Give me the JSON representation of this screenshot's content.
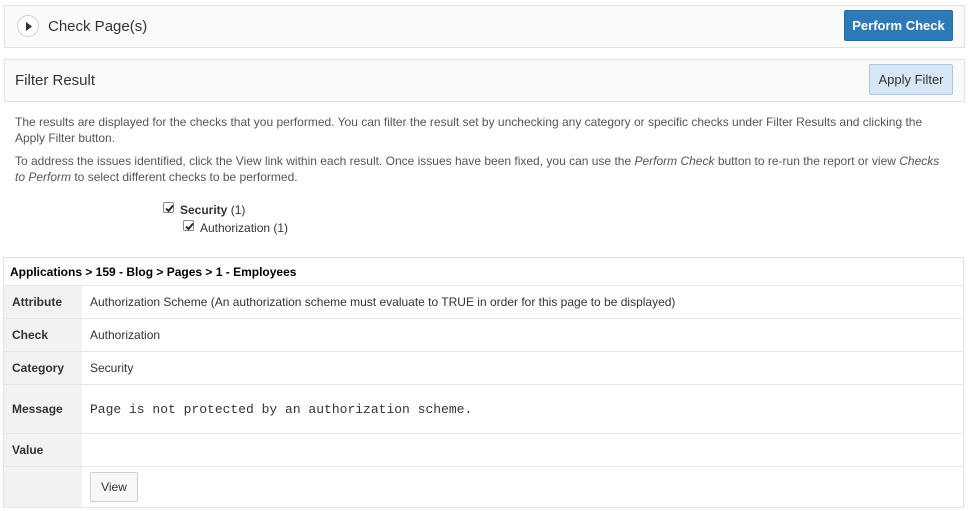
{
  "check_region": {
    "title": "Check Page(s)",
    "perform_button": "Perform Check"
  },
  "filter_region": {
    "title": "Filter Result",
    "apply_button": "Apply Filter"
  },
  "description": {
    "p1": "The results are displayed for the checks that you performed. You can filter the result set by unchecking any category or specific checks under Filter Results and clicking the Apply Filter button.",
    "p2_a": "To address the issues identified, click the View link within each result. Once issues have been fixed, you can use the ",
    "p2_em1": "Perform Check",
    "p2_b": " button to re-run the report or view ",
    "p2_em2": "Checks to Perform",
    "p2_c": " to select different checks to be performed."
  },
  "filters": {
    "category_label": "Security",
    "category_count": "(1)",
    "check_label": "Authorization (1)"
  },
  "result": {
    "path": "Applications > 159 - Blog > Pages > 1 - Employees",
    "rows": [
      {
        "label": "Attribute",
        "value": "Authorization Scheme (An authorization scheme must evaluate to TRUE in order for this page to be displayed)"
      },
      {
        "label": "Check",
        "value": "Authorization"
      },
      {
        "label": "Category",
        "value": "Security"
      },
      {
        "label": "Message",
        "value": "Page is not protected by an authorization scheme."
      },
      {
        "label": "Value",
        "value": ""
      }
    ],
    "view_button": "View"
  }
}
